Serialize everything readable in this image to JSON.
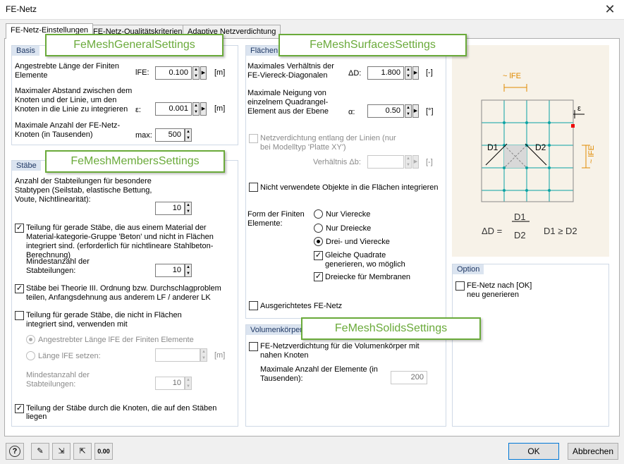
{
  "window": {
    "title": "FE-Netz",
    "close_glyph": "✕"
  },
  "tabs": [
    {
      "label": "FE-Netz-Einstellungen"
    },
    {
      "label": "FE-Netz-Qualitätskriterien"
    },
    {
      "label": "Adaptive Netzverdichtung"
    }
  ],
  "callouts": {
    "general": "FeMeshGeneralSettings",
    "surfaces": "FeMeshSurfacesSettings",
    "members": "FeMeshMembersSettings",
    "solids": "FeMeshSolidsSettings"
  },
  "basis": {
    "header": "Basis",
    "target_length_label": "Angestrebte Länge der Finiten Elemente",
    "target_length_symbol": "lFE:",
    "target_length_value": "0.100",
    "target_length_unit": "[m]",
    "max_distance_label": "Maximaler Abstand zwischen dem Knoten und der Linie, um den Knoten in die Linie zu integrieren",
    "max_distance_symbol": "ε:",
    "max_distance_value": "0.001",
    "max_distance_unit": "[m]",
    "max_nodes_label": "Maximale Anzahl der FE-Netz-Knoten (in Tausenden)",
    "max_nodes_symbol": "max:",
    "max_nodes_value": "500"
  },
  "members": {
    "header": "Stäbe",
    "divisions_label": "Anzahl der Stabteilungen für besondere Stabtypen (Seilstab, elastische Bettung, Voute, Nichtlinearität):",
    "divisions_value": "10",
    "concrete_label": "Teilung für gerade Stäbe, die aus einem Material der Material-kategorie-Gruppe 'Beton' und nicht in Flächen integriert sind. (erforderlich für nichtlineare Stahlbeton-Berechnung)",
    "concrete_checked": "✓",
    "min_divisions_label": "Mindestanzahl der Stabteilungen:",
    "min_divisions_value": "10",
    "third_order_label": "Stäbe bei Theorie III. Ordnung bzw. Durchschlagproblem teilen, Anfangsdehnung aus anderem LF / anderer LK",
    "third_order_checked": "✓",
    "not_integrated_label": "Teilung für gerade Stäbe, die nicht in Flächen integriert sind, verwenden mit",
    "not_integrated_checked": "",
    "radio_target_label": "Angestrebter Länge lFE der Finiten Elemente",
    "radio_set_label": "Länge lFE setzen:",
    "set_length_value": "",
    "set_length_unit": "[m]",
    "min_divisions2_label": "Mindestanzahl der Stabteilungen:",
    "min_divisions2_value": "10",
    "nodes_on_members_label": "Teilung der Stäbe durch die Knoten, die auf den Stäben liegen",
    "nodes_on_members_checked": "✓"
  },
  "surfaces": {
    "header": "Flächen",
    "ratio_label": "Maximales Verhältnis der FE-Viereck-Diagonalen",
    "ratio_symbol": "ΔD:",
    "ratio_value": "1.800",
    "ratio_unit": "[-]",
    "slope_label": "Maximale Neigung von einzelnem Quadrangel-Element aus der Ebene",
    "slope_symbol": "α:",
    "slope_value": "0.50",
    "slope_unit": "[°]",
    "refine_lines_label": "Netzverdichtung entlang der Linien (nur bei Modelltyp 'Platte XY')",
    "refine_ratio_label": "Verhältnis Δb:",
    "refine_ratio_value": "",
    "refine_ratio_unit": "[-]",
    "unused_label": "Nicht verwendete Objekte in die Flächen integrieren",
    "shape_label": "Form der Finiten Elemente:",
    "shape_options": [
      "Nur Vierecke",
      "Nur Dreiecke",
      "Drei- und Vierecke"
    ],
    "equal_squares_label": "Gleiche Quadrate generieren, wo möglich",
    "equal_squares_checked": "✓",
    "triangles_membranes_label": "Dreiecke für Membranen",
    "triangles_membranes_checked": "✓",
    "aligned_label": "Ausgerichtetes FE-Netz"
  },
  "solids": {
    "header": "Volumenkörper",
    "refine_label": "FE-Netzverdichtung für die Volumenkörper mit nahen Knoten",
    "max_elements_label": "Maximale Anzahl der Elemente (in Tausenden):",
    "max_elements_value": "200"
  },
  "figure": {
    "lfe_top": "~ lFE",
    "lfe_right": "~ lFE",
    "epsilon": "ε",
    "d1": "D1",
    "d2": "D2",
    "formula_lhs": "ΔD =",
    "formula_num": "D1",
    "formula_den": "D2",
    "formula_cond": "D1 ≥ D2"
  },
  "option": {
    "header": "Option",
    "regenerate_label": "FE-Netz nach [OK] neu generieren"
  },
  "footer": {
    "ok": "OK",
    "cancel": "Abbrechen",
    "units_icon_text": "0.00"
  }
}
